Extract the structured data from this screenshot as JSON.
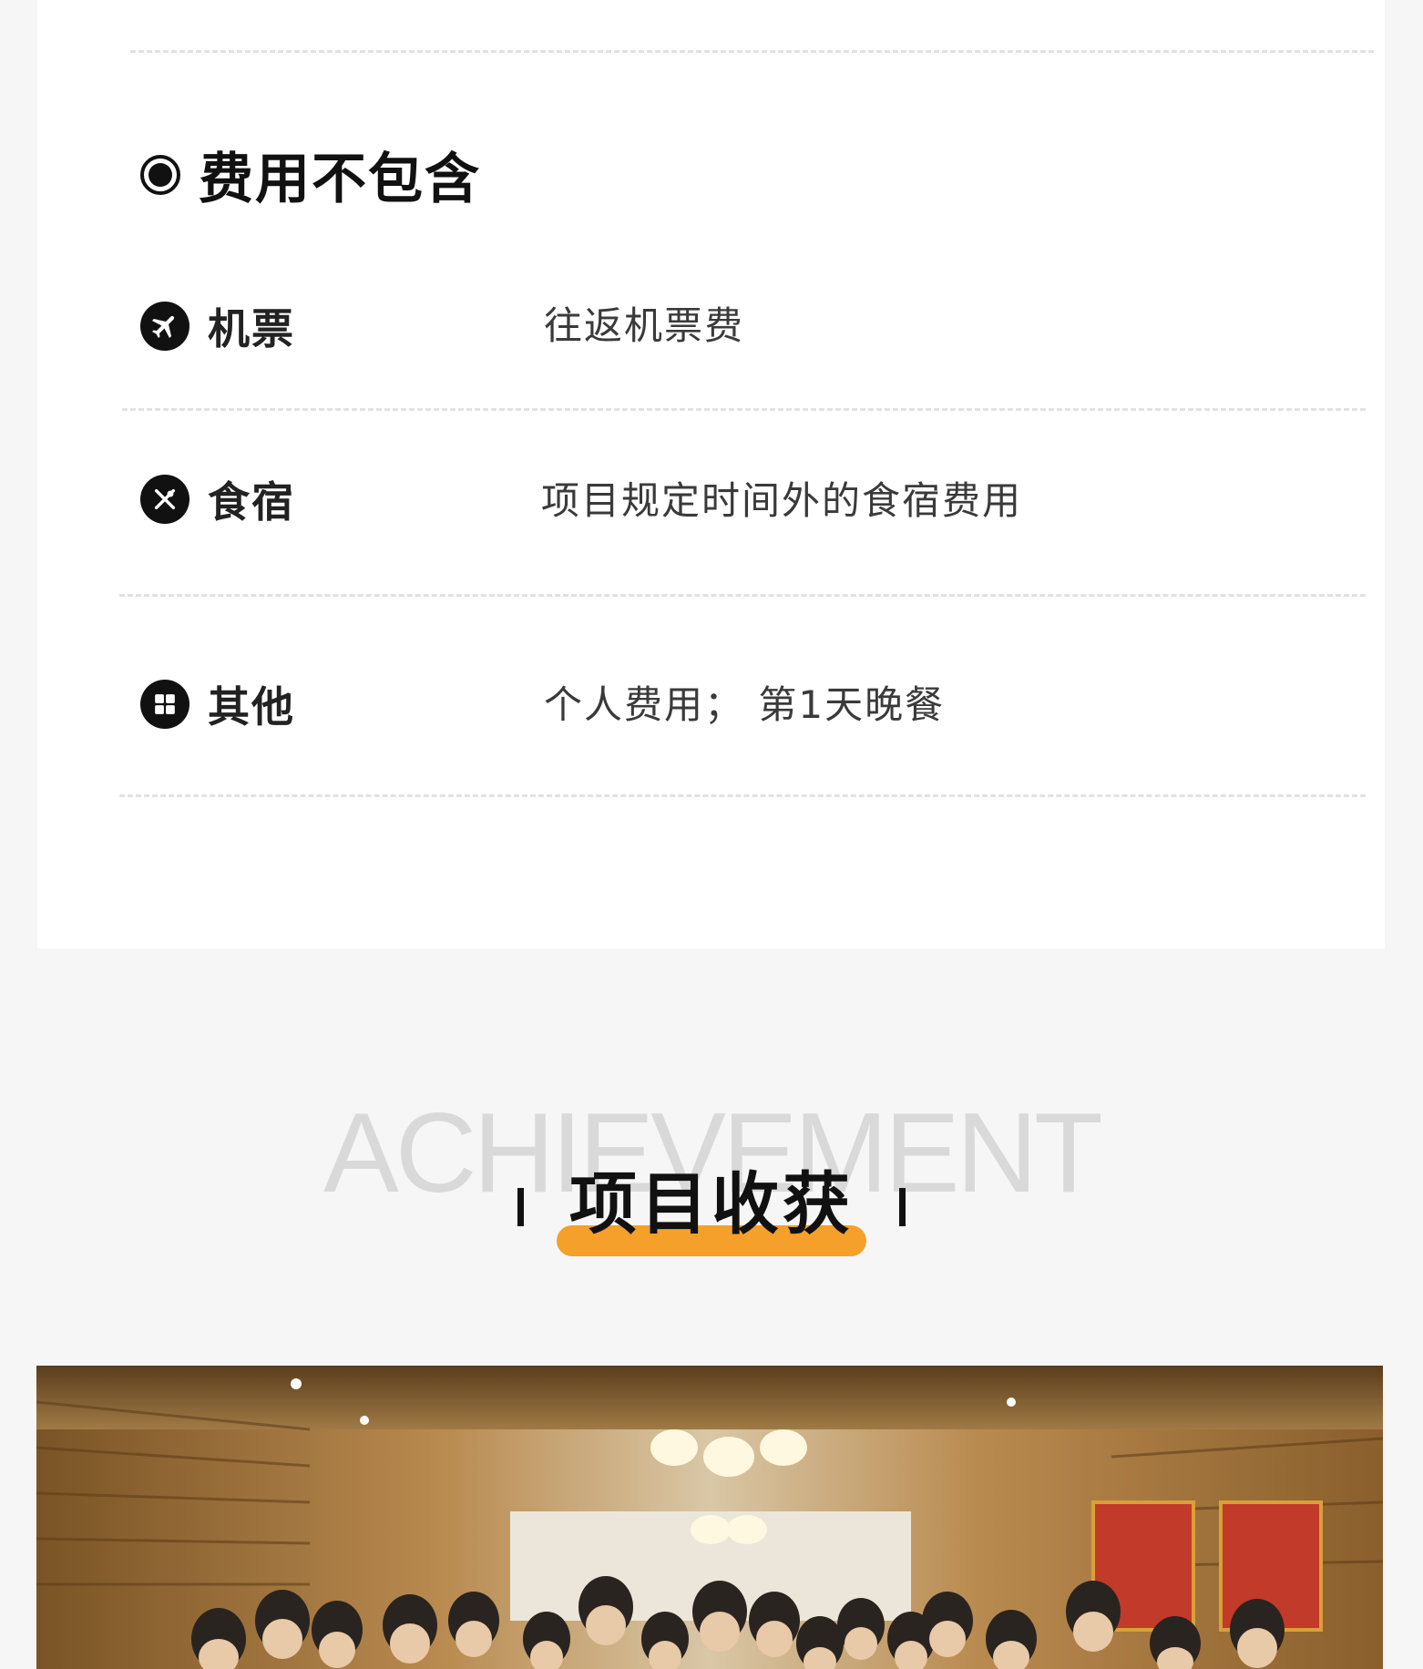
{
  "section": {
    "title": "费用不包含"
  },
  "items": [
    {
      "label": "机票",
      "value": "往返机票费",
      "icon": "airplane-icon"
    },
    {
      "label": "食宿",
      "value": "项目规定时间外的食宿费用",
      "icon": "fork-knife-icon"
    },
    {
      "label": "其他",
      "value": "个人费用；  第1天晚餐",
      "icon": "grid-icon"
    }
  ],
  "achievement": {
    "bg_text": "ACHIEVEMENT",
    "title": "项目收获",
    "accent": "#f5a02a"
  },
  "photo": {
    "icon": "group-photo"
  }
}
